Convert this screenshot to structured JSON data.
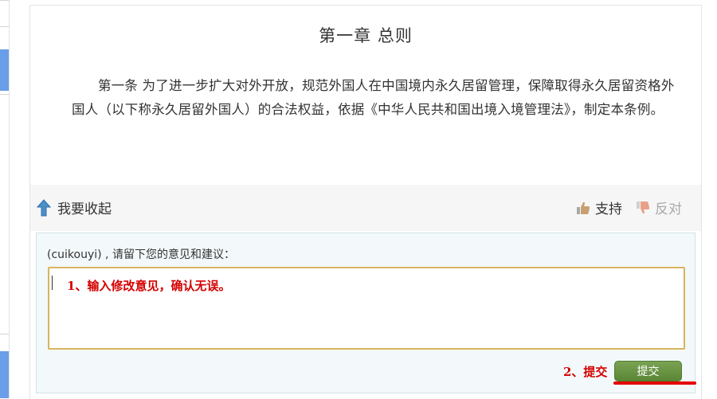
{
  "chapter": {
    "title": "第一章 总则"
  },
  "article": {
    "text": "第一条 为了进一步扩大对外开放，规范外国人在中国境内永久居留管理，保障取得永久居留资格外国人（以下称永久居留外国人）的合法权益，依据《中华人民共和国出境入境管理法》，制定本条例。"
  },
  "actions": {
    "collapse_label": "我要收起",
    "support_label": "支持",
    "oppose_label": "反对",
    "collapse_icon": "up-arrow-icon",
    "support_icon": "thumbs-up-icon",
    "oppose_icon": "thumbs-down-icon"
  },
  "comment": {
    "prompt": "(cuikouyi) , 请留下您的意见和建议：",
    "value": "",
    "annotation_step1": "1、输入修改意见，确认无误。",
    "annotation_step2": "2、提交",
    "submit_label": "提交"
  },
  "colors": {
    "annotation_red": "#d40000",
    "submit_green": "#6a9545",
    "textarea_border": "#d7b45e",
    "sidebar_blue": "#6a9ee8"
  }
}
